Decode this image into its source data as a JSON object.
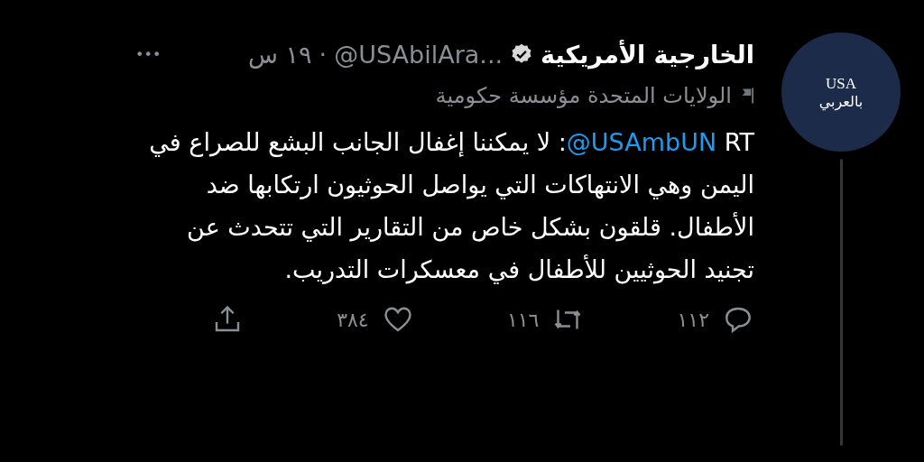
{
  "avatar": {
    "logo_top": "USA",
    "logo_bottom": "بالعربي"
  },
  "header": {
    "name": "الخارجية الأمريكية",
    "verified": true,
    "handle": "@USAbilAra...",
    "separator": "·",
    "time": "١٩ س",
    "more": "•••"
  },
  "label": {
    "text": "الولايات المتحدة مؤسسة حكومية"
  },
  "tweet": {
    "prefix": "RT",
    "mention": "@USAmbUN",
    "text": ": لا يمكننا إغفال الجانب البشع للصراع في اليمن وهي الانتهاكات التي يواصل الحوثيون ارتكابها ضد الأطفال. قلقون بشكل خاص من التقارير التي تتحدث عن تجنيد الحوثيين للأطفال في معسكرات التدريب."
  },
  "actions": [
    {
      "kind": "reply",
      "count": "١١٢"
    },
    {
      "kind": "retweet",
      "count": "١١٦"
    },
    {
      "kind": "like",
      "count": "٣٨٤"
    },
    {
      "kind": "share"
    }
  ]
}
